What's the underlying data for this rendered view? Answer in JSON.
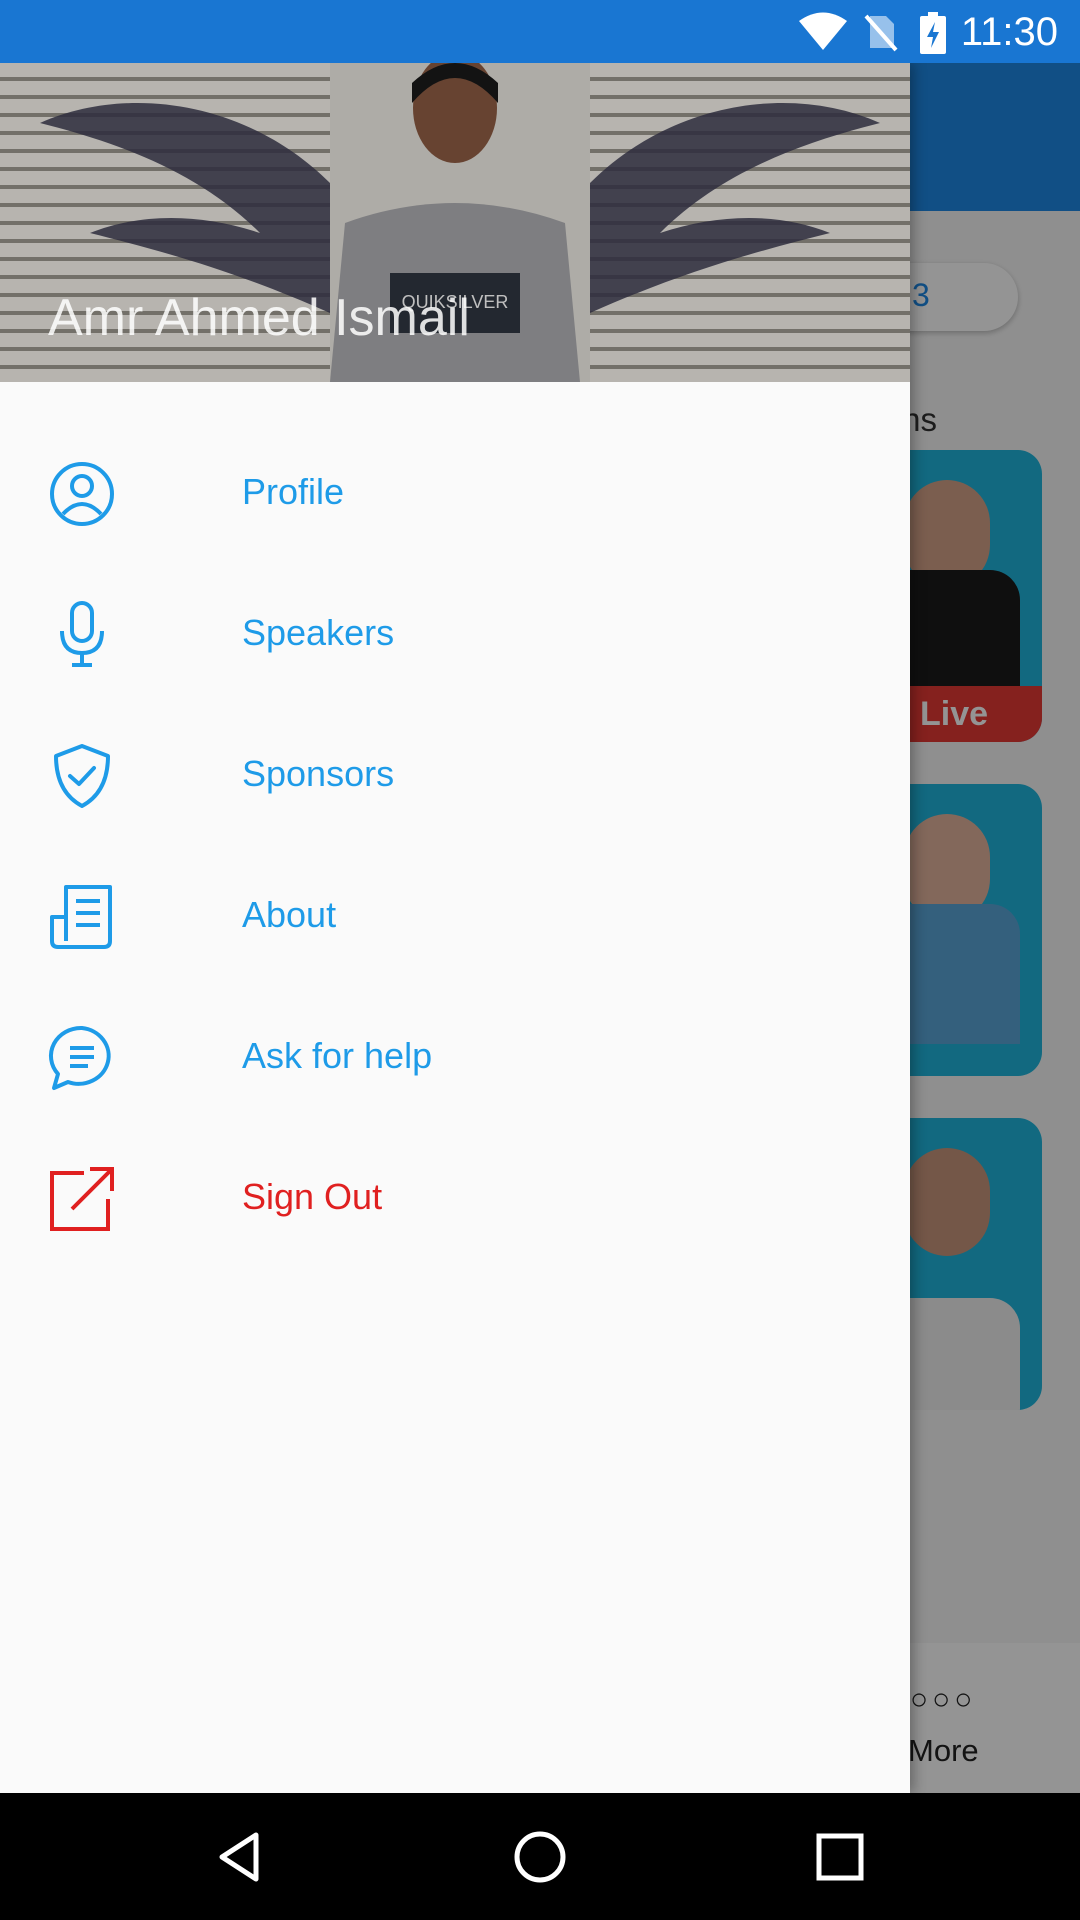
{
  "status_bar": {
    "time": "11:30",
    "icons": [
      "wifi-icon",
      "no-sim-icon",
      "battery-charging-icon"
    ]
  },
  "background_screen": {
    "badge_text": "3",
    "section_heading_partial": "sions",
    "live_label": "Live",
    "more_label": "More",
    "more_icon": "more-dots-icon"
  },
  "drawer": {
    "user_name": "Amr Ahmed Ismail",
    "items": [
      {
        "label": "Profile",
        "icon": "user-circle-icon"
      },
      {
        "label": "Speakers",
        "icon": "microphone-icon"
      },
      {
        "label": "Sponsors",
        "icon": "shield-check-icon"
      },
      {
        "label": "About",
        "icon": "document-icon"
      },
      {
        "label": "Ask for help",
        "icon": "chat-bubble-icon"
      },
      {
        "label": "Sign Out",
        "icon": "external-link-icon"
      }
    ]
  },
  "nav_bar": {
    "buttons": [
      "back-icon",
      "home-icon",
      "recents-icon"
    ]
  },
  "colors": {
    "status_bar": "#1976d2",
    "menu_accent": "#1e9be8",
    "sign_out": "#e02020",
    "live_red": "#e53935",
    "card_blue": "#1fb6dd"
  }
}
